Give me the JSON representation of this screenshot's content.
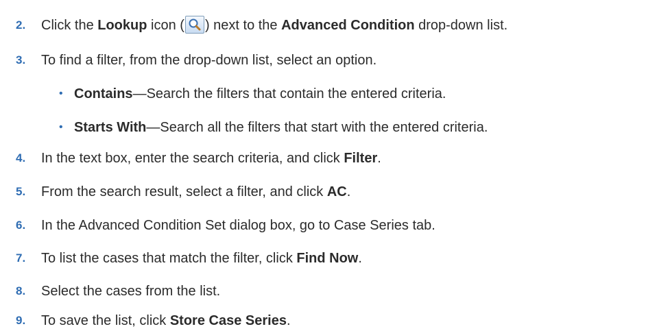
{
  "steps": [
    {
      "number": "2.",
      "parts": [
        "Click the ",
        "Lookup",
        " icon (",
        ") next to the ",
        "Advanced Condition",
        " drop-down list."
      ],
      "icon": "lookup-magnifier-icon"
    },
    {
      "number": "3.",
      "text": "To find a filter, from the drop-down list, select an option.",
      "options": [
        {
          "term": "Contains",
          "desc": "—Search the filters that contain the entered criteria."
        },
        {
          "term": "Starts With",
          "desc": "—Search all the filters that start with the entered criteria."
        }
      ]
    },
    {
      "number": "4.",
      "text": "In the text box, enter the search criteria, and click ",
      "bold": "Filter",
      "end": "."
    },
    {
      "number": "5.",
      "text": "From the search result, select a filter, and click ",
      "bold": "AC",
      "end": "."
    },
    {
      "number": "6.",
      "text": "In the Advanced Condition Set dialog box, go to Case Series tab."
    },
    {
      "number": "7.",
      "text": "To list the cases that match the filter, click ",
      "bold": "Find Now",
      "end": "."
    },
    {
      "number": "8.",
      "text": "Select the cases from the list."
    },
    {
      "number": "9.",
      "text": "To save the list, click ",
      "bold": "Store Case Series",
      "end": "."
    }
  ],
  "bullet_glyph": "•",
  "colors": {
    "step_number": "#2f6db3",
    "text": "#2b2b2b"
  }
}
